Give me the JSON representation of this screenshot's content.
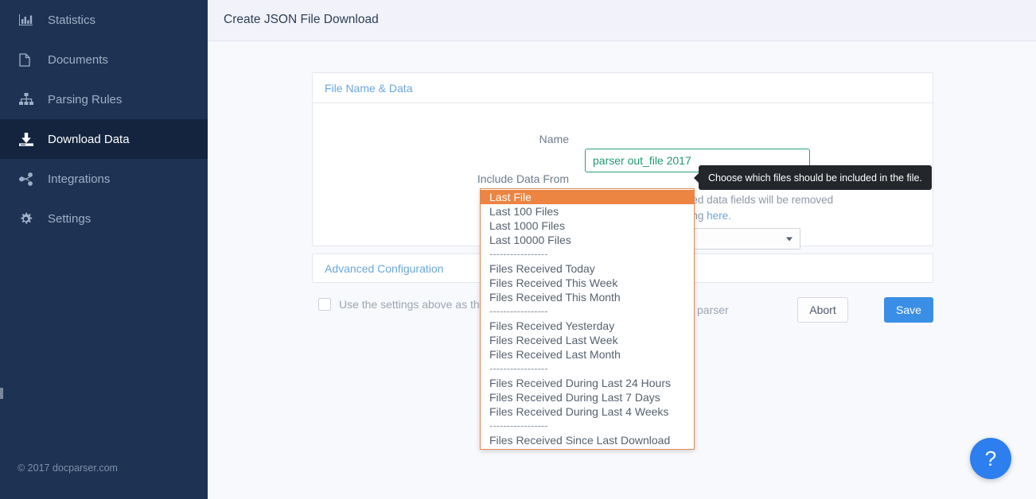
{
  "sidebar": {
    "items": [
      {
        "label": "Statistics",
        "icon": "bar-chart-icon",
        "active": false
      },
      {
        "label": "Documents",
        "icon": "file-icon",
        "active": false
      },
      {
        "label": "Parsing Rules",
        "icon": "sitemap-icon",
        "active": false
      },
      {
        "label": "Download Data",
        "icon": "download-icon",
        "active": true
      },
      {
        "label": "Integrations",
        "icon": "share-icon",
        "active": false
      },
      {
        "label": "Settings",
        "icon": "gear-icon",
        "active": false
      }
    ],
    "footer": "© 2017 docparser.com",
    "bg_color": "#1e3354",
    "active_bg_color": "#14243f"
  },
  "header": {
    "title": "Create JSON File Download"
  },
  "panels": {
    "file_name_data": {
      "title": "File Name & Data",
      "name_label": "Name",
      "name_value": "parser out_file 2017",
      "include_label": "Include Data From",
      "include_value": "Last File",
      "info_text_line1": "settings, files and parsed data fields will be removed",
      "info_text_line2": "u can change this setting ",
      "info_link": "here",
      "info_text_end": "."
    },
    "advanced": {
      "title": "Advanced Configuration"
    }
  },
  "bottom": {
    "checkbox_label": "Use the settings above as the",
    "checkbox_label_tail": "is parser",
    "abort_label": "Abort",
    "save_label": "Save"
  },
  "tooltip": {
    "text": "Choose which files should be included in the file."
  },
  "help": {
    "glyph": "?"
  },
  "dropdown": {
    "accent_color": "#ec8442",
    "border_color": "#e08a53",
    "items": [
      {
        "label": "Last File",
        "type": "option",
        "selected": true
      },
      {
        "label": "Last 100 Files",
        "type": "option",
        "selected": false
      },
      {
        "label": "Last 1000 Files",
        "type": "option",
        "selected": false
      },
      {
        "label": "Last 10000 Files",
        "type": "option",
        "selected": false
      },
      {
        "label": "-----------------",
        "type": "separator",
        "selected": false
      },
      {
        "label": "Files Received Today",
        "type": "option",
        "selected": false
      },
      {
        "label": "Files Received This Week",
        "type": "option",
        "selected": false
      },
      {
        "label": "Files Received This Month",
        "type": "option",
        "selected": false
      },
      {
        "label": "-----------------",
        "type": "separator",
        "selected": false
      },
      {
        "label": "Files Received Yesterday",
        "type": "option",
        "selected": false
      },
      {
        "label": "Files Received Last Week",
        "type": "option",
        "selected": false
      },
      {
        "label": "Files Received Last Month",
        "type": "option",
        "selected": false
      },
      {
        "label": "-----------------",
        "type": "separator",
        "selected": false
      },
      {
        "label": "Files Received During Last 24 Hours",
        "type": "option",
        "selected": false
      },
      {
        "label": "Files Received During Last 7 Days",
        "type": "option",
        "selected": false
      },
      {
        "label": "Files Received During Last 4 Weeks",
        "type": "option",
        "selected": false
      },
      {
        "label": "-----------------",
        "type": "separator",
        "selected": false
      },
      {
        "label": "Files Received Since Last Download",
        "type": "option",
        "selected": false
      }
    ]
  }
}
